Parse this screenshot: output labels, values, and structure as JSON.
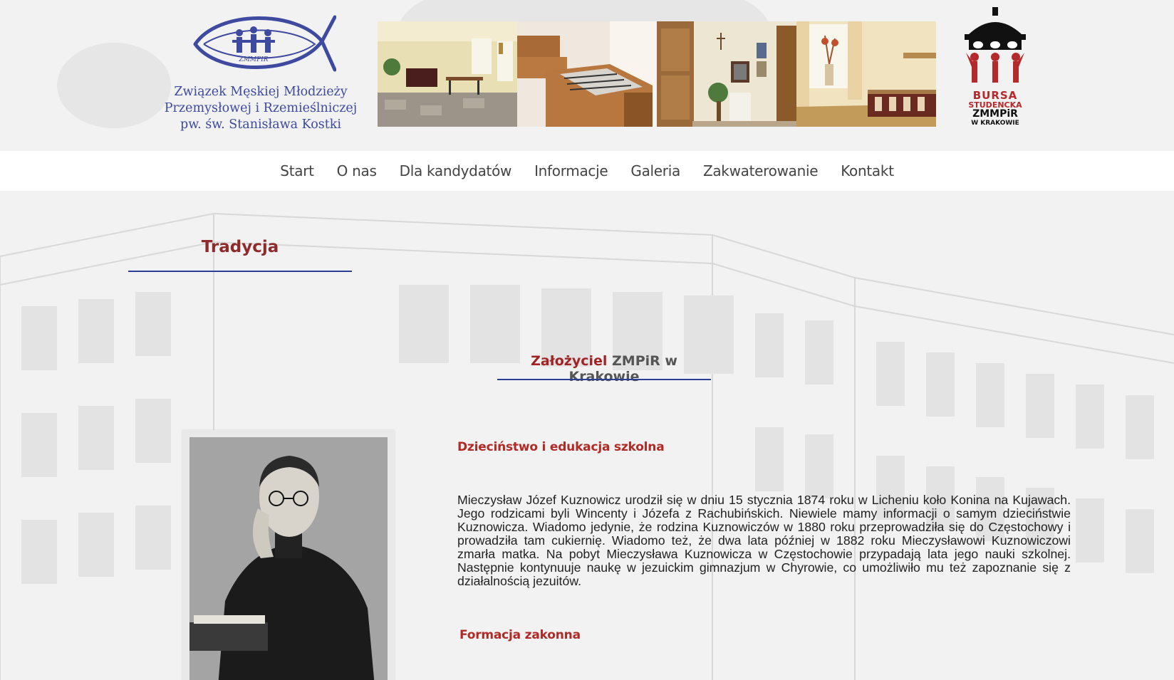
{
  "org_name": {
    "line1": "Związek Męskiej Młodzieży",
    "line2": "Przemysłowej i Rzemieślniczej",
    "line3": "pw. św. Stanisława Kostki"
  },
  "logo_fish_text": "ZMMPIR",
  "logo_bursa": {
    "line1": "BURSA",
    "line2": "STUDENCKA",
    "line3": "ZMMPiR",
    "line4": "W KRAKOWIE"
  },
  "nav": {
    "items": [
      {
        "label": "Start"
      },
      {
        "label": "O nas"
      },
      {
        "label": "Dla kandydatów"
      },
      {
        "label": "Informacje"
      },
      {
        "label": "Galeria"
      },
      {
        "label": "Zakwaterowanie"
      },
      {
        "label": "Kontakt"
      }
    ]
  },
  "page": {
    "section_title": "Tradycja",
    "subtitle_accent": "Założyciel",
    "subtitle_rest": " ZMPiR w Krakowie",
    "heading1": "Dzieciństwo i edukacja szkolna",
    "paragraph1": "Mieczysław Józef Kuznowicz urodził się w dniu 15 stycznia 1874 roku w Licheniu koło Konina na Kujawach. Jego rodzicami byli Wincenty i Józefa z Rachubińskich. Niewiele mamy informacji o samym dzieciństwie Kuznowicza. Wiadomo jedynie, że rodzina Kuznowiczów w 1880 roku przeprowadziła się do Częstochowy i prowadziła tam cukiernię. Wiadomo też, że dwa lata później w 1882 roku Mieczysławowi Kuznowiczowi zmarła matka. Na pobyt Mieczysława Kuznowicza w Częstochowie przypadają lata jego nauki szkolnej. Następnie kontynuuje naukę w jezuickim gimnazjum w Chyrowie, co umożliwiło mu też zapoznanie się z działalnością jezuitów.",
    "heading2": "Formacja zakonna"
  },
  "colors": {
    "accent_red": "#b12a25",
    "title_red": "#8e2a2a",
    "rule_blue": "#2a3f96",
    "org_blue": "#3d4aa0",
    "nav_text": "#444444"
  }
}
